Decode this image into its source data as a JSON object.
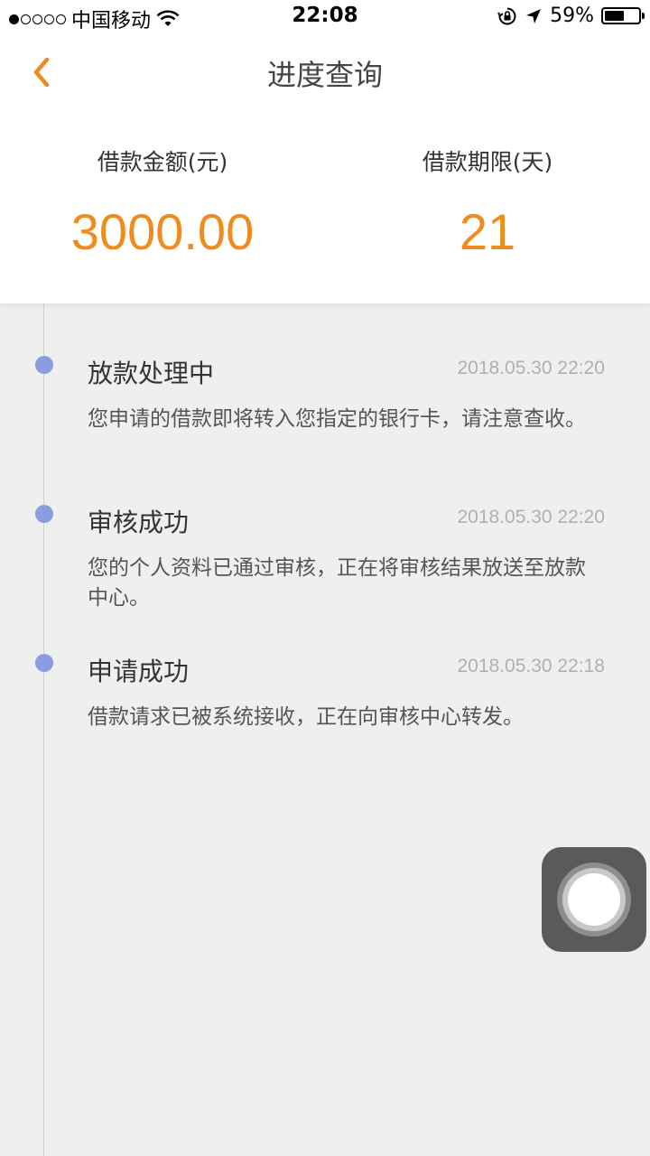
{
  "status_bar": {
    "carrier": "中国移动",
    "time": "22:08",
    "battery_percent": "59%",
    "battery_level": 0.59,
    "signal_strength": 1,
    "signal_max": 5
  },
  "nav": {
    "title": "进度查询",
    "back_icon": "chevron-left-icon"
  },
  "summary": {
    "amount_label": "借款金额(元)",
    "amount_value": "3000.00",
    "term_label": "借款期限(天)",
    "term_value": "21"
  },
  "timeline": [
    {
      "title": "放款处理中",
      "time": "2018.05.30 22:20",
      "desc": "您申请的借款即将转入您指定的银行卡，请注意查收。"
    },
    {
      "title": "审核成功",
      "time": "2018.05.30 22:20",
      "desc": "您的个人资料已通过审核，正在将审核结果放送至放款中心。"
    },
    {
      "title": "申请成功",
      "time": "2018.05.30 22:18",
      "desc": "借款请求已被系统接收，正在向审核中心转发。"
    }
  ],
  "colors": {
    "accent": "#f08c1e",
    "timeline_dot": "#8a9de0"
  }
}
